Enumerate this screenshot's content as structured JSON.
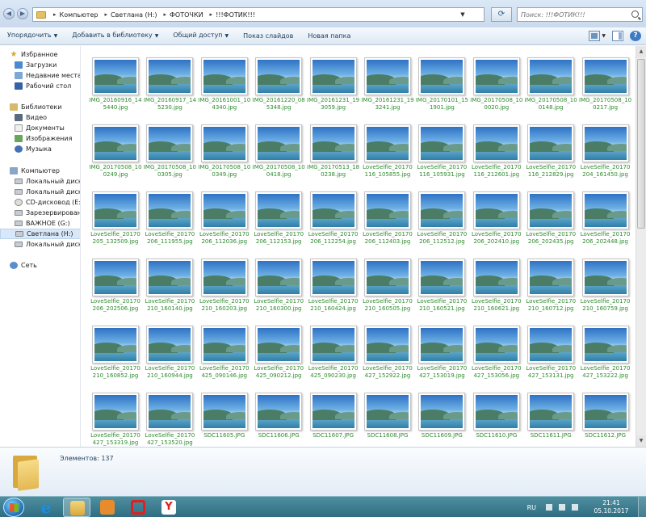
{
  "address": {
    "crumbs": [
      "Компьютер",
      "Светлана (H:)",
      "ФОТОЧКИ",
      "!!!ФОТИК!!!"
    ],
    "search_placeholder": "Поиск: !!!ФОТИК!!!"
  },
  "toolbar": {
    "organize": "Упорядочить",
    "add_library": "Добавить в библиотеку",
    "share": "Общий доступ",
    "slideshow": "Показ слайдов",
    "new_folder": "Новая папка"
  },
  "nav": {
    "favorites": {
      "header": "Избранное",
      "items": [
        "Загрузки",
        "Недавние места",
        "Рабочий стол"
      ]
    },
    "libraries": {
      "header": "Библиотеки",
      "items": [
        "Видео",
        "Документы",
        "Изображения",
        "Музыка"
      ]
    },
    "computer": {
      "header": "Компьютер",
      "items": [
        "Локальный диск (C:)",
        "Локальный диск (D:)",
        "CD-дисковод (E:)",
        "Зарезервировано системой (F:)",
        "ВАЖНОЕ (G:)",
        "Светлана (H:)",
        "Локальный диск (I:)"
      ]
    },
    "network": {
      "header": "Сеть"
    }
  },
  "files": [
    [
      "IMG_20160916_14",
      "5440.jpg"
    ],
    [
      "IMG_20160917_14",
      "5230.jpg"
    ],
    [
      "IMG_20161001_10",
      "4340.jpg"
    ],
    [
      "IMG_20161220_08",
      "5348.jpg"
    ],
    [
      "IMG_20161231_19",
      "3059.jpg"
    ],
    [
      "IMG_20161231_19",
      "3241.jpg"
    ],
    [
      "IMG_20170101_15",
      "1901.jpg"
    ],
    [
      "IMG_20170508_10",
      "0020.jpg"
    ],
    [
      "IMG_20170508_10",
      "0148.jpg"
    ],
    [
      "IMG_20170508_10",
      "0217.jpg"
    ],
    [
      "IMG_20170508_10",
      "0249.jpg"
    ],
    [
      "IMG_20170508_10",
      "0305.jpg"
    ],
    [
      "IMG_20170508_10",
      "0349.jpg"
    ],
    [
      "IMG_20170508_10",
      "0418.jpg"
    ],
    [
      "IMG_20170513_18",
      "0238.jpg"
    ],
    [
      "LoveSelfie_20170",
      "116_105855.jpg"
    ],
    [
      "LoveSelfie_20170",
      "116_105931.jpg"
    ],
    [
      "LoveSelfie_20170",
      "116_212601.jpg"
    ],
    [
      "LoveSelfie_20170",
      "116_212829.jpg"
    ],
    [
      "LoveSelfie_20170",
      "204_161450.jpg"
    ],
    [
      "LoveSelfie_20170",
      "205_132509.jpg"
    ],
    [
      "LoveSelfie_20170",
      "206_111955.jpg"
    ],
    [
      "LoveSelfie_20170",
      "206_112036.jpg"
    ],
    [
      "LoveSelfie_20170",
      "206_112153.jpg"
    ],
    [
      "LoveSelfie_20170",
      "206_112254.jpg"
    ],
    [
      "LoveSelfie_20170",
      "206_112403.jpg"
    ],
    [
      "LoveSelfie_20170",
      "206_112512.jpg"
    ],
    [
      "LoveSelfie_20170",
      "206_202410.jpg"
    ],
    [
      "LoveSelfie_20170",
      "206_202435.jpg"
    ],
    [
      "LoveSelfie_20170",
      "206_202448.jpg"
    ],
    [
      "LoveSelfie_20170",
      "206_202506.jpg"
    ],
    [
      "LoveSelfie_20170",
      "210_160140.jpg"
    ],
    [
      "LoveSelfie_20170",
      "210_160203.jpg"
    ],
    [
      "LoveSelfie_20170",
      "210_160300.jpg"
    ],
    [
      "LoveSelfie_20170",
      "210_160424.jpg"
    ],
    [
      "LoveSelfie_20170",
      "210_160505.jpg"
    ],
    [
      "LoveSelfie_20170",
      "210_160521.jpg"
    ],
    [
      "LoveSelfie_20170",
      "210_160621.jpg"
    ],
    [
      "LoveSelfie_20170",
      "210_160712.jpg"
    ],
    [
      "LoveSelfie_20170",
      "210_160759.jpg"
    ],
    [
      "LoveSelfie_20170",
      "210_160852.jpg"
    ],
    [
      "LoveSelfie_20170",
      "210_160944.jpg"
    ],
    [
      "LoveSelfie_20170",
      "425_090146.jpg"
    ],
    [
      "LoveSelfie_20170",
      "425_090212.jpg"
    ],
    [
      "LoveSelfie_20170",
      "425_090230.jpg"
    ],
    [
      "LoveSelfie_20170",
      "427_152922.jpg"
    ],
    [
      "LoveSelfie_20170",
      "427_153019.jpg"
    ],
    [
      "LoveSelfie_20170",
      "427_153056.jpg"
    ],
    [
      "LoveSelfie_20170",
      "427_153131.jpg"
    ],
    [
      "LoveSelfie_20170",
      "427_153222.jpg"
    ],
    [
      "LoveSelfie_20170",
      "427_153319.jpg"
    ],
    [
      "LoveSelfie_20170",
      "427_153520.jpg"
    ],
    [
      "SDC11605.JPG"
    ],
    [
      "SDC11606.JPG"
    ],
    [
      "SDC11607.JPG"
    ],
    [
      "SDC11608.JPG"
    ],
    [
      "SDC11609.JPG"
    ],
    [
      "SDC11610.JPG"
    ],
    [
      "SDC11611.JPG"
    ],
    [
      "SDC11612.JPG"
    ]
  ],
  "details": {
    "count": "Элементов: 137"
  },
  "taskbar": {
    "lang": "RU",
    "time": "21:41",
    "date": "05.10.2017",
    "apps": [
      "internet-explorer",
      "windows-explorer",
      "media-player",
      "opera",
      "yandex-browser"
    ]
  }
}
